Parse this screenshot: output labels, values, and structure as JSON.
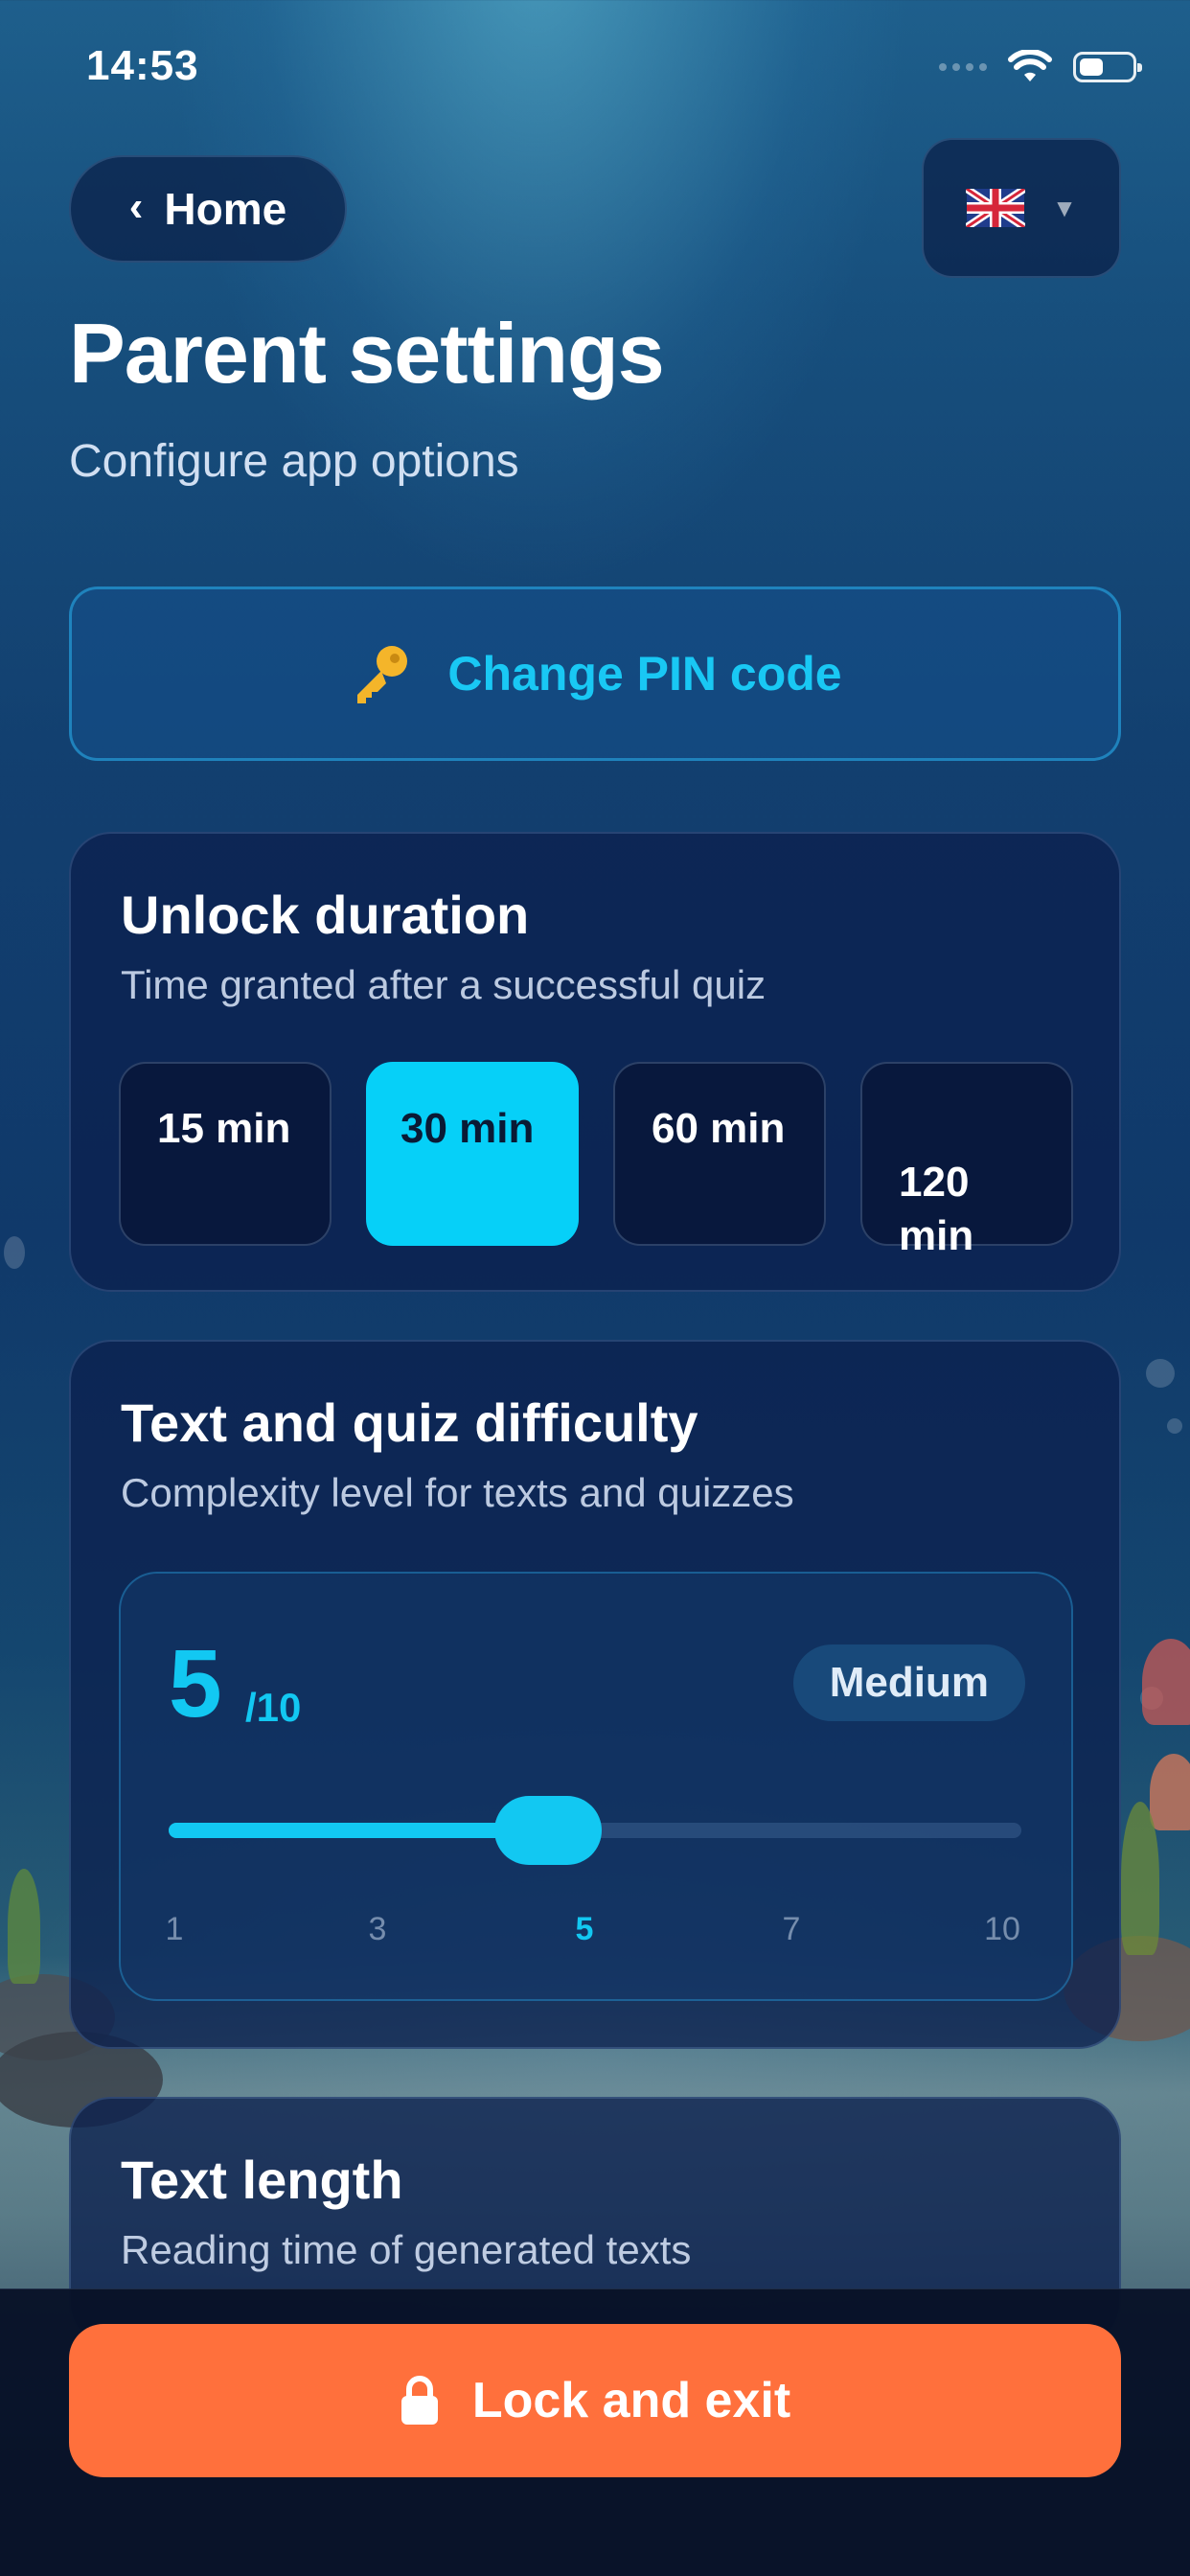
{
  "status_bar": {
    "time": "14:53"
  },
  "header": {
    "back_label": "Home",
    "language_flag": "uk-flag-icon",
    "title": "Parent settings",
    "subtitle": "Configure app options"
  },
  "change_pin": {
    "icon": "key-icon",
    "label": "Change PIN code"
  },
  "unlock_duration": {
    "title": "Unlock duration",
    "subtitle": "Time granted after a successful quiz",
    "options": [
      {
        "label": "15 min",
        "selected": false
      },
      {
        "label": "30 min",
        "selected": true
      },
      {
        "label": "60 min",
        "selected": false
      },
      {
        "label": "120\nmin",
        "selected": false
      }
    ]
  },
  "difficulty": {
    "title": "Text and quiz difficulty",
    "subtitle": "Complexity level for texts and quizzes",
    "value": "5",
    "max_label": "/10",
    "level_label": "Medium",
    "slider_min": 1,
    "slider_max": 10,
    "slider_value": 5,
    "ticks": [
      "1",
      "3",
      "5",
      "7",
      "10"
    ]
  },
  "text_length": {
    "title": "Text length",
    "subtitle": "Reading time of generated texts"
  },
  "footer": {
    "icon": "lock-icon",
    "lock_label": "Lock and exit"
  },
  "colors": {
    "accent": "#12c8f2",
    "selected_option": "#06d0f8",
    "lock_button": "#ff703c",
    "card_bg": "#0c204e"
  }
}
